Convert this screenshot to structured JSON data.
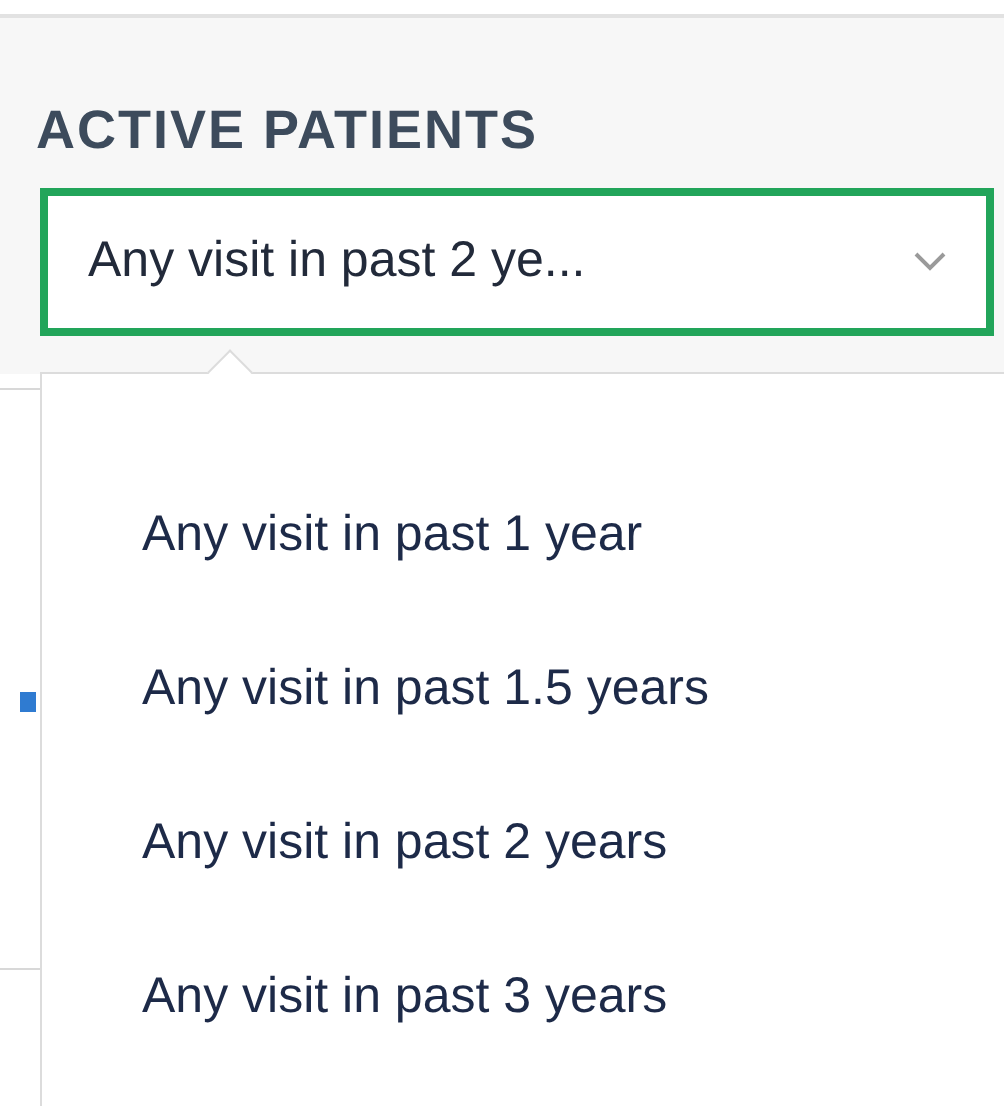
{
  "filter": {
    "title": "ACTIVE PATIENTS",
    "select": {
      "value": "Any visit in past 2 ye...",
      "open": true
    },
    "options": [
      {
        "label": "Any visit in past 1 year"
      },
      {
        "label": "Any visit in past 1.5 years"
      },
      {
        "label": "Any visit in past 2 years"
      },
      {
        "label": "Any visit in past 3 years"
      }
    ]
  }
}
